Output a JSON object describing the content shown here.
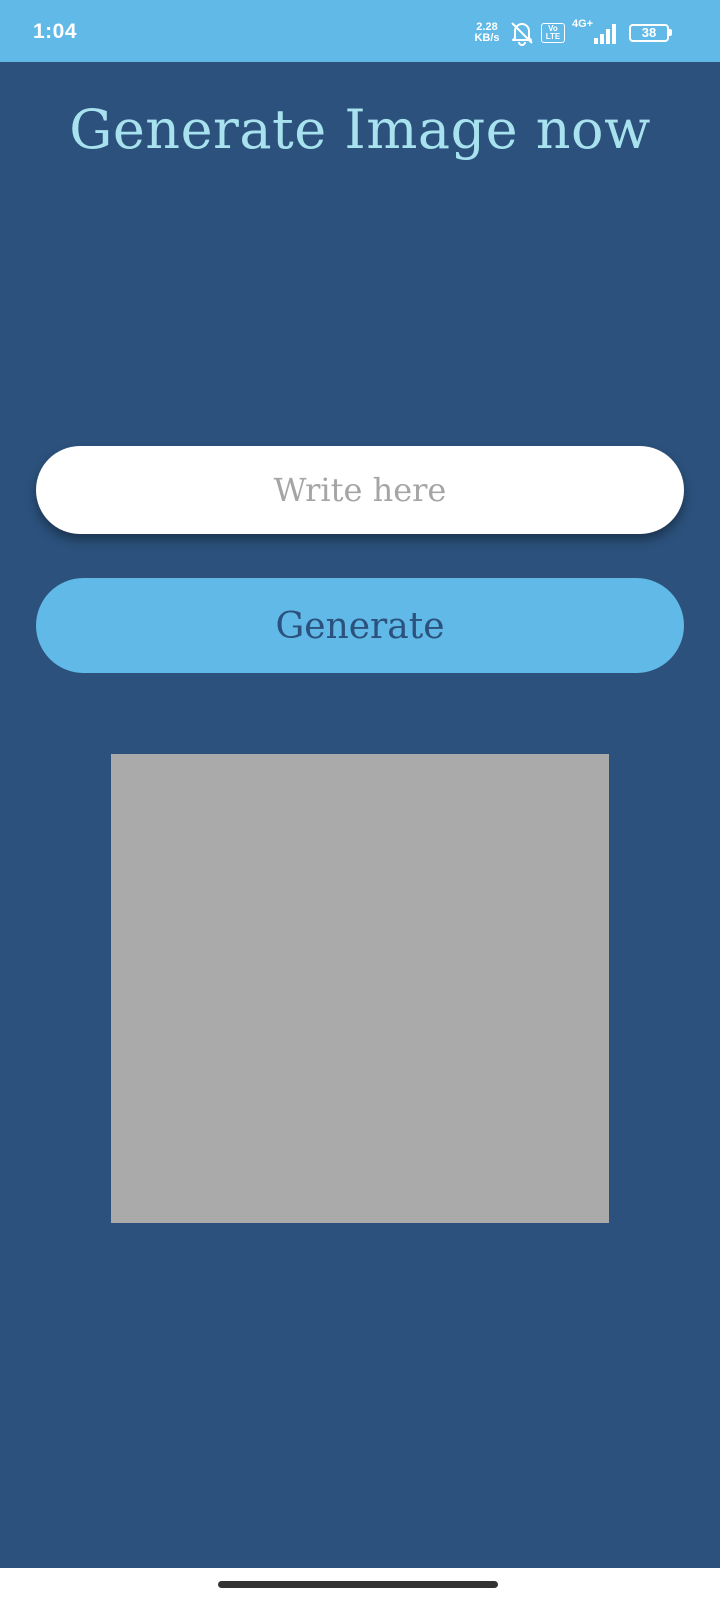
{
  "status_bar": {
    "time": "1:04",
    "net_speed_value": "2.28",
    "net_speed_unit": "KB/s",
    "volte_top": "Vo",
    "volte_bottom": "LTE",
    "network_type": "4G+",
    "battery_level": "38",
    "icons": [
      "bell-muted-icon",
      "volte-icon",
      "signal-icon",
      "battery-icon"
    ]
  },
  "header": {
    "title": "Generate Image now"
  },
  "form": {
    "prompt_placeholder": "Write here",
    "prompt_value": "",
    "generate_label": "Generate"
  },
  "colors": {
    "background": "#2b517c",
    "accent": "#60b9e7",
    "title": "#a7e2ee",
    "placeholder_image": "#aaaaaa"
  }
}
